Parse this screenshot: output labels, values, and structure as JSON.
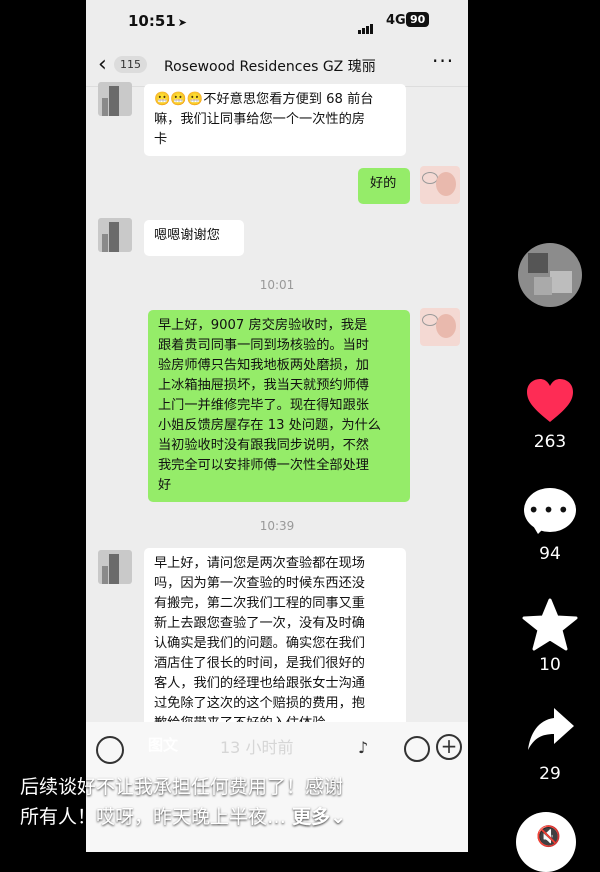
{
  "status": {
    "time": "10:51",
    "network": "4G",
    "battery": "90"
  },
  "header": {
    "unread": "115",
    "title": "Rosewood Residences GZ 瑰丽"
  },
  "messages": [
    {
      "lines": [
        "😬😬😬不好意思您看方便到 68 前台",
        "嘛，我们让同事给您一个一次性的房",
        "卡"
      ]
    },
    {
      "lines": [
        "好的"
      ]
    },
    {
      "lines": [
        "嗯嗯谢谢您"
      ]
    },
    {
      "lines": [
        "早上好，9007 房交房验收时，我是",
        "跟着贵司同事一同到场核验的。当时",
        "验房师傅只告知我地板两处磨损，加",
        "上冰箱抽屉损坏，我当天就预约师傅",
        "上门一并维修完毕了。现在得知跟张",
        "小姐反馈房屋存在 13 处问题，为什么",
        "当初验收时没有跟我同步说明，不然",
        "我完全可以安排师傅一次性全部处理",
        "好"
      ]
    },
    {
      "lines": [
        "早上好，请问您是两次查验都在现场",
        "吗，因为第一次查验的时候东西还没",
        "有搬完，第二次我们工程的同事又重",
        "新上去跟您查验了一次，没有及时确",
        "认确实是我们的问题。确实您在我们",
        "酒店住了很长的时间，是我们很好的",
        "客人，我们的经理也给跟张女士沟通",
        "过免除了这次的这个赔损的费用，抱",
        "歉给您带来了不好的入住体验"
      ]
    }
  ],
  "timestamps": [
    "10:01",
    "10:39"
  ],
  "overlay": {
    "tag": "图文",
    "timestamp": "13 小时前"
  },
  "caption": {
    "line1": "后续谈好不让我承担任何费用了！感谢",
    "line2": "所有人！哎呀，昨天晚上半夜…",
    "more": "更多⌄"
  },
  "side": {
    "likes": "263",
    "comments": "94",
    "favorites": "10",
    "shares": "29"
  },
  "colors": {
    "chat_bg": "#ededed",
    "bubble_me": "#95ec69",
    "like": "#fe2c55"
  }
}
